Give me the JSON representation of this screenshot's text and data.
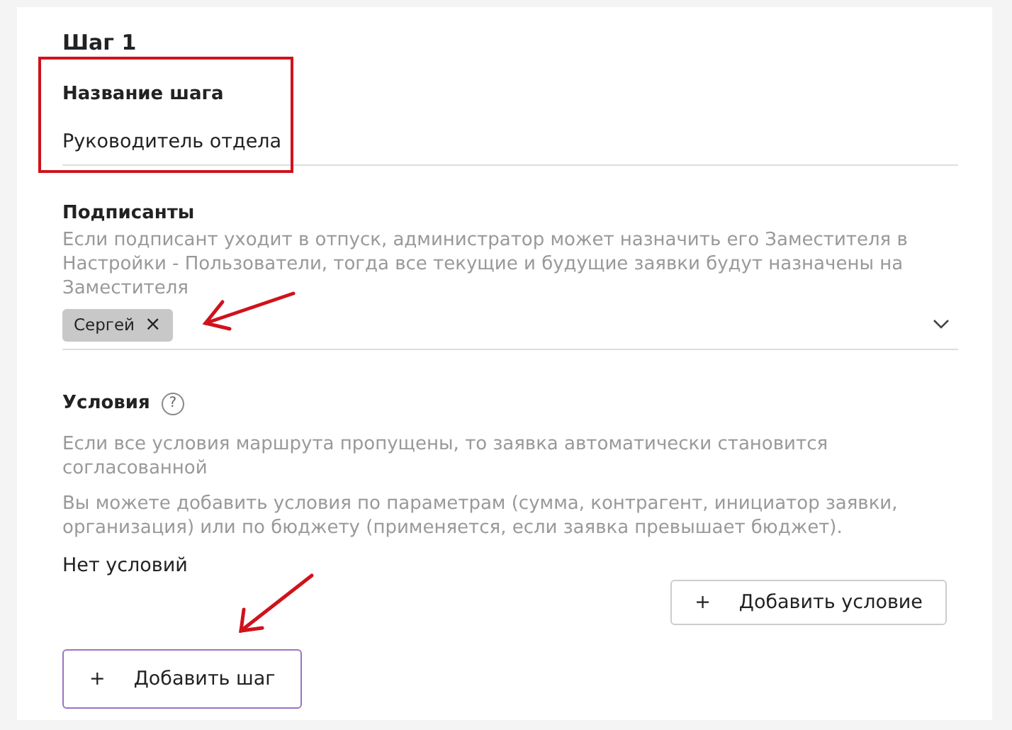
{
  "step": {
    "title": "Шаг 1"
  },
  "name_field": {
    "label": "Название шага",
    "value": "Руководитель отдела"
  },
  "signers": {
    "label": "Подписанты",
    "hint": "Если подписант уходит в отпуск, администратор может назначить его Заместителя в Настройки - Пользователи, тогда все текущие и будущие заявки будут назначены на Заместителя",
    "chips": [
      {
        "label": "Сергей",
        "remove": "×"
      }
    ]
  },
  "conditions": {
    "label": "Условия",
    "help": "?",
    "notes": [
      "Если все условия маршрута пропущены, то заявка автоматически становится согласованной",
      "Вы можете добавить условия по параметрам (сумма, контрагент, инициатор заявки, организация) или по бюджету (применяется, если заявка превышает бюджет)."
    ],
    "empty": "Нет условий",
    "add_button": {
      "icon": "+",
      "label": "Добавить условие"
    }
  },
  "add_step_button": {
    "icon": "+",
    "label": "Добавить шаг"
  }
}
